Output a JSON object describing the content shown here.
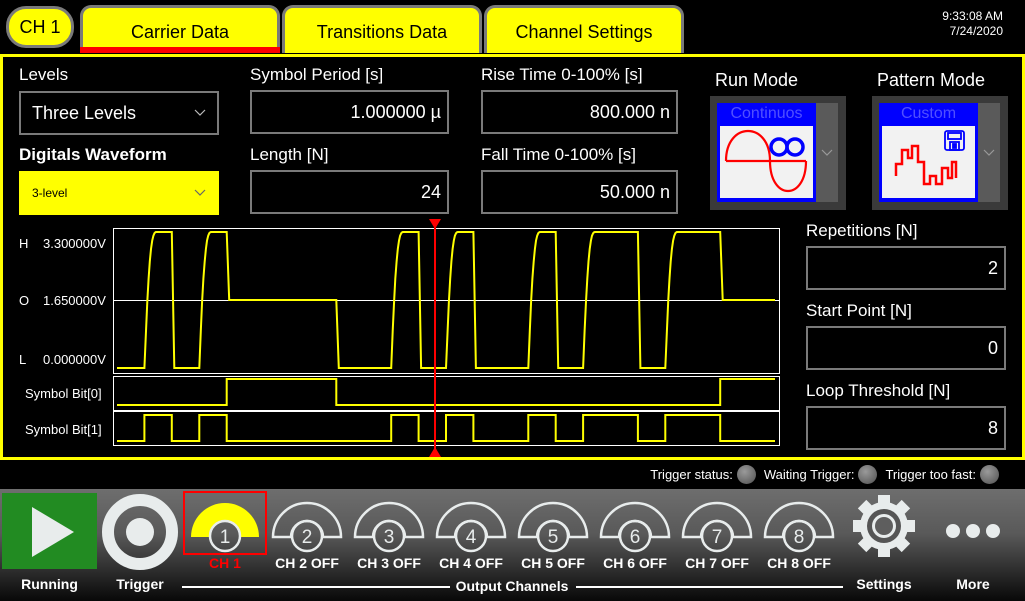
{
  "header": {
    "channel_badge": "CH 1",
    "tabs": [
      {
        "label": "Carrier Data",
        "active": true
      },
      {
        "label": "Transitions Data",
        "active": false
      },
      {
        "label": "Channel Settings",
        "active": false
      }
    ],
    "time": "9:33:08 AM",
    "date": "7/24/2020"
  },
  "carrier": {
    "levels_label": "Levels",
    "levels_value": "Three Levels",
    "digitals_waveform_label": "Digitals Waveform",
    "digitals_waveform_value": "3-level",
    "symbol_period_label": "Symbol Period [s]",
    "symbol_period_value": "1.000000 µ",
    "length_label": "Length [N]",
    "length_value": "24",
    "rise_time_label": "Rise Time 0-100% [s]",
    "rise_time_value": "800.000 n",
    "fall_time_label": "Fall Time 0-100% [s]",
    "fall_time_value": "50.000 n",
    "run_mode_label": "Run Mode",
    "run_mode_value": "Continuos",
    "pattern_mode_label": "Pattern Mode",
    "pattern_mode_value": "Custom",
    "repetitions_label": "Repetitions [N]",
    "repetitions_value": "2",
    "start_point_label": "Start Point [N]",
    "start_point_value": "0",
    "loop_threshold_label": "Loop Threshold [N]",
    "loop_threshold_value": "8"
  },
  "chart_data": {
    "type": "line",
    "title": "",
    "xlabel": "",
    "ylabel": "",
    "y_level_labels": [
      {
        "key": "H",
        "value": "3.300000V"
      },
      {
        "key": "O",
        "value": "1.650000V"
      },
      {
        "key": "L",
        "value": "0.000000V"
      }
    ],
    "ylim": [
      0,
      3.3
    ],
    "symbol_count": 24,
    "symbols": [
      "L",
      "H",
      "L",
      "H",
      "O",
      "O",
      "O",
      "O",
      "L",
      "L",
      "H",
      "L",
      "H",
      "L",
      "L",
      "H",
      "L",
      "H",
      "H",
      "L",
      "H",
      "H",
      "O",
      "O"
    ],
    "series": [
      {
        "name": "Waveform",
        "unit": "V",
        "level_values": {
          "L": 0.0,
          "O": 1.65,
          "H": 3.3
        }
      },
      {
        "name": "Symbol Bit[0]",
        "values": [
          0,
          0,
          0,
          0,
          1,
          1,
          1,
          1,
          0,
          0,
          0,
          0,
          0,
          0,
          0,
          0,
          0,
          0,
          0,
          0,
          0,
          0,
          1,
          1
        ]
      },
      {
        "name": "Symbol Bit[1]",
        "values": [
          0,
          1,
          0,
          1,
          0,
          0,
          0,
          0,
          0,
          0,
          1,
          0,
          1,
          0,
          0,
          1,
          0,
          1,
          1,
          0,
          1,
          1,
          0,
          0
        ]
      }
    ],
    "cursor_symbol_position": 12,
    "line_color": "#ffff00",
    "cursor_color": "#ff0000",
    "grid": false
  },
  "status": {
    "trigger_status_label": "Trigger status:",
    "waiting_trigger_label": "Waiting Trigger:",
    "trigger_too_fast_label": "Trigger too fast:"
  },
  "toolbar": {
    "running_label": "Running",
    "trigger_label": "Trigger",
    "output_channels_label": "Output Channels",
    "settings_label": "Settings",
    "more_label": "More",
    "channels": [
      {
        "number": "1",
        "label": "CH 1",
        "on": true
      },
      {
        "number": "2",
        "label": "CH 2 OFF",
        "on": false
      },
      {
        "number": "3",
        "label": "CH 3 OFF",
        "on": false
      },
      {
        "number": "4",
        "label": "CH 4 OFF",
        "on": false
      },
      {
        "number": "5",
        "label": "CH 5 OFF",
        "on": false
      },
      {
        "number": "6",
        "label": "CH 6 OFF",
        "on": false
      },
      {
        "number": "7",
        "label": "CH 7 OFF",
        "on": false
      },
      {
        "number": "8",
        "label": "CH 8 OFF",
        "on": false
      }
    ]
  },
  "colors": {
    "accent_yellow": "#ffff00",
    "selection_red": "#ff0000",
    "run_green": "#228b22",
    "mode_blue": "#0000ff"
  }
}
